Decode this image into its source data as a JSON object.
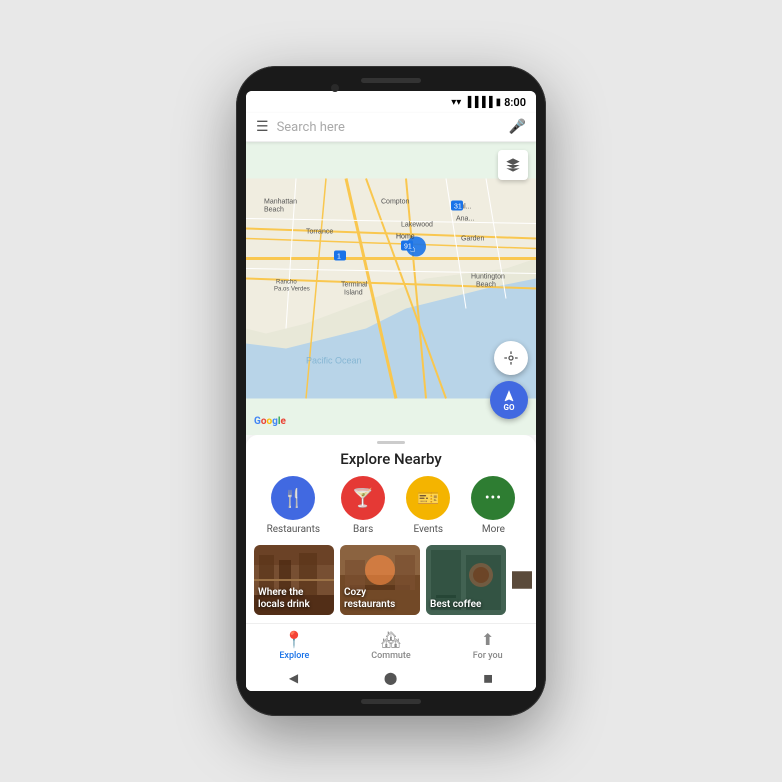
{
  "statusBar": {
    "time": "8:00"
  },
  "searchBar": {
    "placeholder": "Search here"
  },
  "mapBtn": {
    "go": "GO"
  },
  "googleLogo": [
    "G",
    "o",
    "o",
    "g",
    "l",
    "e"
  ],
  "exploreSection": {
    "title": "Explore Nearby",
    "categories": [
      {
        "id": "restaurants",
        "label": "Restaurants",
        "colorClass": "cat-restaurants",
        "icon": "🍴"
      },
      {
        "id": "bars",
        "label": "Bars",
        "colorClass": "cat-bars",
        "icon": "🍸"
      },
      {
        "id": "events",
        "label": "Events",
        "colorClass": "cat-events",
        "icon": "🎫"
      },
      {
        "id": "more",
        "label": "More",
        "colorClass": "cat-more",
        "icon": "···"
      }
    ],
    "placeCards": [
      {
        "id": "locals-drink",
        "label": "Where the locals drink",
        "bg": "#7B5E3A"
      },
      {
        "id": "cozy-restaurants",
        "label": "Cozy restaurants",
        "bg": "#8B6340"
      },
      {
        "id": "best-coffee",
        "label": "Best coffee",
        "bg": "#5A7A6A"
      },
      {
        "id": "more-card",
        "label": "...",
        "bg": "#6A5A4A"
      }
    ]
  },
  "bottomNav": [
    {
      "id": "explore",
      "label": "Explore",
      "icon": "📍",
      "active": true
    },
    {
      "id": "commute",
      "label": "Commute",
      "icon": "🏠",
      "active": false
    },
    {
      "id": "for-you",
      "label": "For you",
      "icon": "⬆",
      "active": false
    }
  ],
  "androidNav": {
    "back": "◀",
    "home": "⬤",
    "recents": "◼"
  }
}
